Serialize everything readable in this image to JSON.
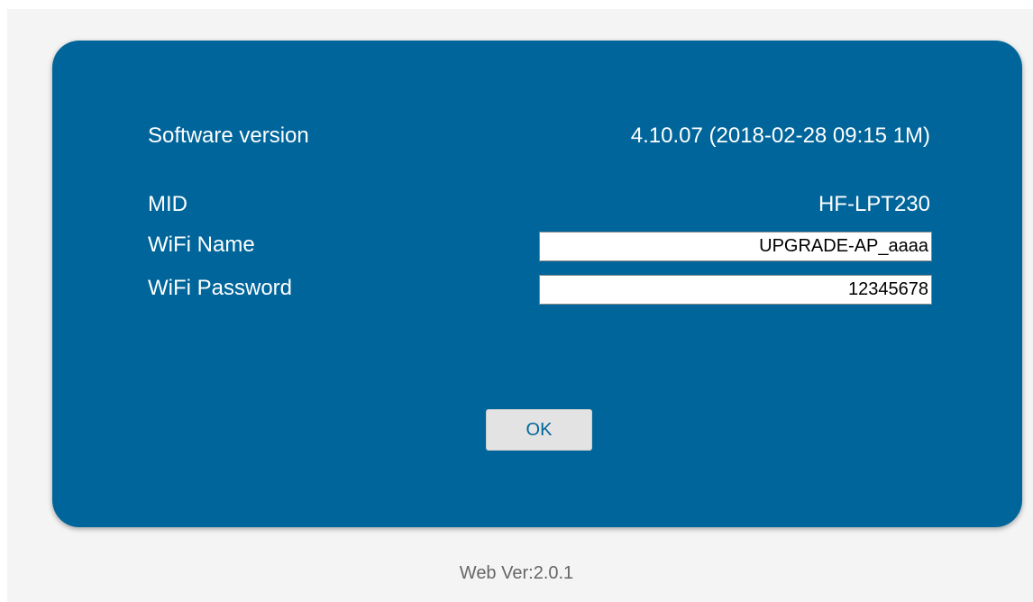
{
  "form": {
    "software_version_label": "Software version",
    "software_version_value": "4.10.07 (2018-02-28 09:15 1M)",
    "mid_label": "MID",
    "mid_value": "HF-LPT230",
    "wifi_name_label": "WiFi Name",
    "wifi_name_value": "UPGRADE-AP_aaaa",
    "wifi_password_label": "WiFi Password",
    "wifi_password_value": "12345678",
    "ok_label": "OK"
  },
  "footer": {
    "web_version": "Web Ver:2.0.1"
  },
  "colors": {
    "panel": "#00659a",
    "page_background": "#f4f4f4",
    "button_background": "#e3e3e3",
    "button_text": "#00659a",
    "footer_text": "#666666"
  }
}
